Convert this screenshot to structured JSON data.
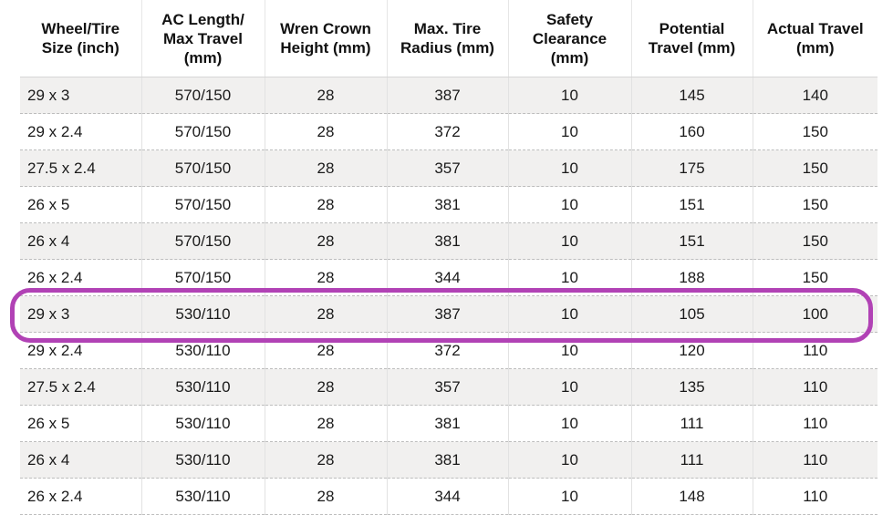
{
  "table": {
    "headers": [
      [
        "Wheel/Tire",
        "Size (inch)"
      ],
      [
        "AC Length/",
        "Max Travel",
        "(mm)"
      ],
      [
        "Wren Crown",
        "Height (mm)"
      ],
      [
        "Max. Tire",
        "Radius (mm)"
      ],
      [
        "Safety",
        "Clearance",
        "(mm)"
      ],
      [
        "Potential",
        "Travel (mm)"
      ],
      [
        "Actual Travel",
        "(mm)"
      ]
    ],
    "rows": [
      [
        "29 x 3",
        "570/150",
        "28",
        "387",
        "10",
        "145",
        "140"
      ],
      [
        "29 x 2.4",
        "570/150",
        "28",
        "372",
        "10",
        "160",
        "150"
      ],
      [
        "27.5 x 2.4",
        "570/150",
        "28",
        "357",
        "10",
        "175",
        "150"
      ],
      [
        "26 x 5",
        "570/150",
        "28",
        "381",
        "10",
        "151",
        "150"
      ],
      [
        "26 x 4",
        "570/150",
        "28",
        "381",
        "10",
        "151",
        "150"
      ],
      [
        "26 x 2.4",
        "570/150",
        "28",
        "344",
        "10",
        "188",
        "150"
      ],
      [
        "29 x 3",
        "530/110",
        "28",
        "387",
        "10",
        "105",
        "100"
      ],
      [
        "29 x 2.4",
        "530/110",
        "28",
        "372",
        "10",
        "120",
        "110"
      ],
      [
        "27.5 x 2.4",
        "530/110",
        "28",
        "357",
        "10",
        "135",
        "110"
      ],
      [
        "26 x 5",
        "530/110",
        "28",
        "381",
        "10",
        "111",
        "110"
      ],
      [
        "26 x 4",
        "530/110",
        "28",
        "381",
        "10",
        "111",
        "110"
      ],
      [
        "26 x 2.4",
        "530/110",
        "28",
        "344",
        "10",
        "148",
        "110"
      ]
    ],
    "highlighted_row_index": 6
  },
  "colors": {
    "highlight": "#b142b5",
    "stripe": "#f1f0ef"
  }
}
